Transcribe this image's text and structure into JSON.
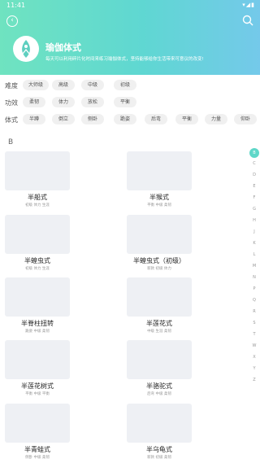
{
  "status": {
    "time": "11:41",
    "icons": "▾◢▮"
  },
  "header": {
    "title": "瑜伽体式",
    "description": "每天可以利用碎片化时间来练习瑜伽体式，坚持能够给你生活带来可意议的改变!"
  },
  "filters": {
    "difficulty": {
      "label": "难度",
      "chips": [
        "大师级",
        "高级",
        "中级",
        "初级"
      ]
    },
    "efficacy": {
      "label": "功效",
      "chips": [
        "柔韧",
        "体力",
        "放松",
        "平衡"
      ]
    },
    "posture": {
      "label": "体式",
      "chips": [
        "半蹲",
        "倒立",
        "侧卧",
        "跪姿",
        "后弯",
        "平衡",
        "力量",
        "仰卧"
      ]
    }
  },
  "section": "B",
  "poses": [
    {
      "name": "半船式",
      "tags": "初级 体力 生涯"
    },
    {
      "name": "半猴式",
      "tags": "平衡 中级 柔韧"
    },
    {
      "name": "半蝗虫式",
      "tags": "初级 体力 生涯"
    },
    {
      "name": "半蝗虫式（初级）",
      "tags": "新款 初级 体力"
    },
    {
      "name": "半脊柱扭转",
      "tags": "跪姿 中级 柔韧"
    },
    {
      "name": "半莲花式",
      "tags": "中级 生涯 柔韧"
    },
    {
      "name": "半莲花树式",
      "tags": "平衡 中级 平衡"
    },
    {
      "name": "半骆驼式",
      "tags": "后弯 中级 柔韧"
    },
    {
      "name": "半青蛙式",
      "tags": "侧卧 中级 柔韧"
    },
    {
      "name": "半乌龟式",
      "tags": "新款 初级 柔韧"
    }
  ],
  "index": [
    "B",
    "C",
    "D",
    "E",
    "F",
    "G",
    "H",
    "J",
    "K",
    "L",
    "M",
    "N",
    "P",
    "Q",
    "R",
    "S",
    "T",
    "W",
    "X",
    "Y",
    "Z"
  ]
}
